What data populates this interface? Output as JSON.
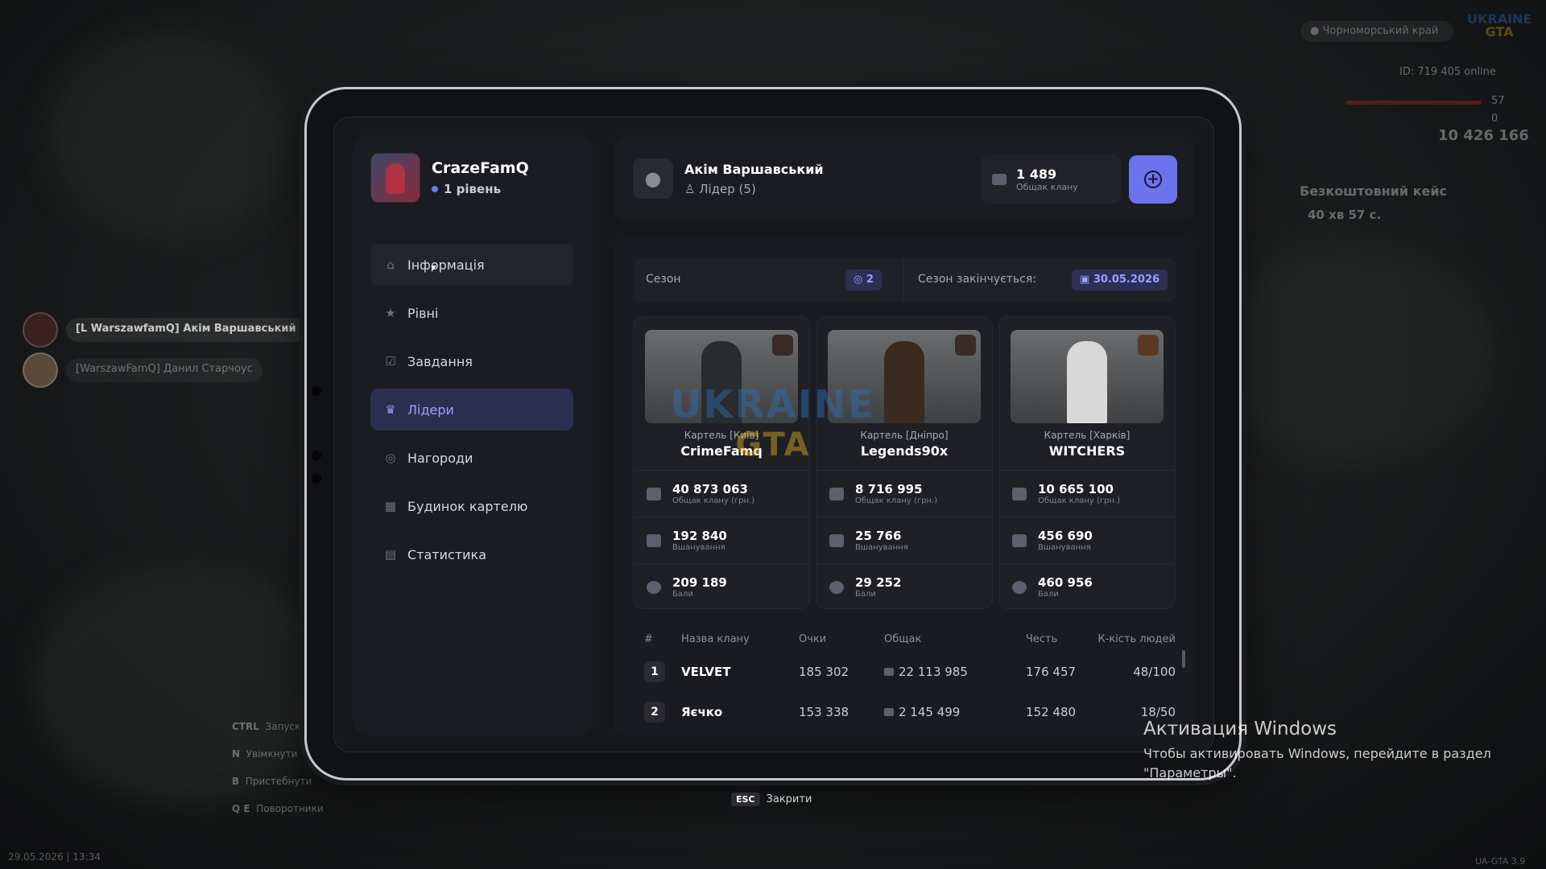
{
  "hud": {
    "region": "Чорноморський край",
    "id_online": "ID: 719   405 online",
    "hp": "57",
    "armor": "0",
    "money": "10 426 166",
    "free_case_title": "Безкоштовний кейс",
    "free_case_timer": "40 хв 57 с.",
    "datetime": "29.05.2026 | 13:34",
    "version": "UA-GTA 3.9",
    "logo_top": "UKRAINE",
    "logo_bottom": "GTA"
  },
  "hints": [
    {
      "key": "CTRL",
      "label": "Запуск"
    },
    {
      "key": "N",
      "label": "Увімкнути"
    },
    {
      "key": "B",
      "label": "Пристебнути"
    },
    {
      "key": "Q E",
      "label": "Поворотники"
    }
  ],
  "chat_players": [
    {
      "name": "[L WarszawfamQ] Акім Варшавський"
    },
    {
      "name": "[WarszawFamQ] Данил Старчоус"
    }
  ],
  "profile": {
    "name": "CrazeFamQ",
    "level": "1 рівень"
  },
  "menu": [
    {
      "label": "Інформація",
      "icon": "home-icon",
      "state": "hover"
    },
    {
      "label": "Рівні",
      "icon": "star-icon",
      "state": ""
    },
    {
      "label": "Завдання",
      "icon": "checkbox-icon",
      "state": ""
    },
    {
      "label": "Лідери",
      "icon": "crown-icon",
      "state": "active"
    },
    {
      "label": "Нагороди",
      "icon": "medal-icon",
      "state": ""
    },
    {
      "label": "Будинок картелю",
      "icon": "building-icon",
      "state": ""
    },
    {
      "label": "Статистика",
      "icon": "chart-icon",
      "state": ""
    }
  ],
  "user": {
    "name": "Акім Варшавський",
    "role": "Лідер (5)"
  },
  "balance": {
    "value": "1 489",
    "label": "Общак клану"
  },
  "season": {
    "label": "Сезон",
    "number": "2",
    "ends_label": "Сезон закінчується:",
    "ends_date": "30.05.2026"
  },
  "leaders": [
    {
      "subtitle": "Картель [Київ]",
      "name": "CrimeFamq",
      "cash": "40 873 063",
      "cash_label": "Общак клану (грн.)",
      "honor": "192 840",
      "honor_label": "Вшанування",
      "points": "209 189",
      "points_label": "Бали"
    },
    {
      "subtitle": "Картель [Дніпро]",
      "name": "Legends90x",
      "cash": "8 716 995",
      "cash_label": "Общак клану (грн.)",
      "honor": "25 766",
      "honor_label": "Вшанування",
      "points": "29 252",
      "points_label": "Бали"
    },
    {
      "subtitle": "Картель [Харків]",
      "name": "WITCHERS",
      "cash": "10 665 100",
      "cash_label": "Общак клану (грн.)",
      "honor": "456 690",
      "honor_label": "Вшанування",
      "points": "460 956",
      "points_label": "Бали"
    }
  ],
  "table": {
    "headers": [
      "#",
      "Назва клану",
      "Очки",
      "Общак",
      "Честь",
      "К-кість людей"
    ],
    "rows": [
      {
        "rank": "1",
        "clan": "VELVET",
        "points": "185 302",
        "cash": "22 113 985",
        "honor": "176 457",
        "members": "48/100"
      },
      {
        "rank": "2",
        "clan": "Яєчко",
        "points": "153 338",
        "cash": "2 145 499",
        "honor": "152 480",
        "members": "18/50"
      }
    ]
  },
  "close_hint": {
    "key": "ESC",
    "label": "Закрити"
  },
  "watermark": {
    "top": "UKRAINE",
    "bottom": "GTA"
  },
  "windows_activation": {
    "title": "Активация Windows",
    "line1": "Чтобы активировать Windows, перейдите в раздел",
    "line2": "\"Параметры\"."
  }
}
